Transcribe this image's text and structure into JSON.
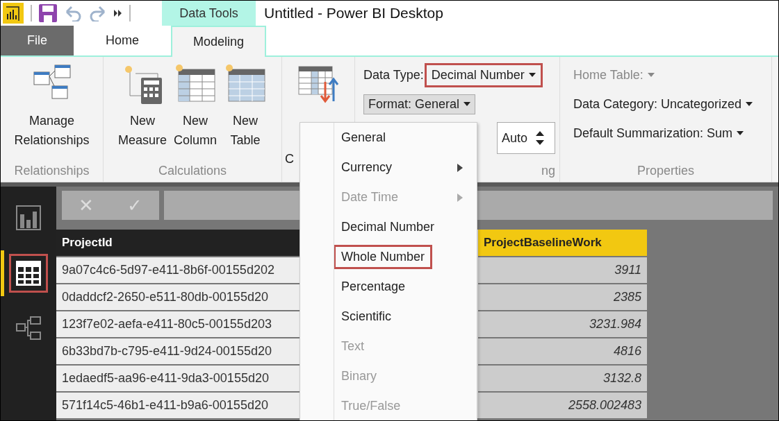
{
  "window": {
    "title": "Untitled - Power BI Desktop",
    "context_tab": "Data Tools"
  },
  "tabs": [
    {
      "label": "File",
      "kind": "file",
      "selected": false
    },
    {
      "label": "Home",
      "kind": "tab",
      "selected": false
    },
    {
      "label": "Modeling",
      "kind": "tab",
      "selected": true
    }
  ],
  "ribbon": {
    "relationships": {
      "buttons": [
        {
          "label": "Manage Relationships",
          "kind": "relationships"
        }
      ],
      "group_label": "Relationships"
    },
    "calculations": {
      "buttons": [
        {
          "label": "New Measure",
          "kind": "measure"
        },
        {
          "label": "New Column",
          "kind": "column"
        },
        {
          "label": "New Table",
          "kind": "table"
        }
      ],
      "group_label": "Calculations"
    },
    "sort": {
      "label_visible": "C"
    },
    "formatting": {
      "data_type_label": "Data Type:",
      "data_type_value": "Decimal Number",
      "data_type_highlighted": true,
      "format_button": "Format: General",
      "format_open": true,
      "decimals": "Auto",
      "group_label_visible": "ng"
    },
    "properties": {
      "items": [
        {
          "label": "Home Table:",
          "disabled": true
        },
        {
          "label": "Data Category: Uncategorized",
          "disabled": false
        },
        {
          "label": "Default Summarization: Sum",
          "disabled": false
        }
      ],
      "group_label": "Properties"
    }
  },
  "nav": [
    {
      "kind": "report",
      "selected": false,
      "highlighted": false
    },
    {
      "kind": "data",
      "selected": true,
      "highlighted": true
    },
    {
      "kind": "model",
      "selected": false,
      "highlighted": false
    }
  ],
  "formula_bar": {
    "cancel": "✕",
    "confirm": "✓"
  },
  "format_menu": [
    {
      "label": "General",
      "disabled": false,
      "submenu": false,
      "highlighted": false
    },
    {
      "label": "Currency",
      "disabled": false,
      "submenu": true,
      "highlighted": false
    },
    {
      "label": "Date Time",
      "disabled": true,
      "submenu": true,
      "highlighted": false
    },
    {
      "label": "Decimal Number",
      "disabled": false,
      "submenu": false,
      "highlighted": false
    },
    {
      "label": "Whole Number",
      "disabled": false,
      "submenu": false,
      "highlighted": true
    },
    {
      "label": "Percentage",
      "disabled": false,
      "submenu": false,
      "highlighted": false
    },
    {
      "label": "Scientific",
      "disabled": false,
      "submenu": false,
      "highlighted": false
    },
    {
      "label": "Text",
      "disabled": true,
      "submenu": false,
      "highlighted": false
    },
    {
      "label": "Binary",
      "disabled": true,
      "submenu": false,
      "highlighted": false
    },
    {
      "label": "True/False",
      "disabled": true,
      "submenu": false,
      "highlighted": false
    }
  ],
  "table": {
    "columns": [
      {
        "label": "ProjectId",
        "selected": false
      },
      {
        "label": "ProjectBaselineWork",
        "selected": true
      }
    ],
    "rows": [
      [
        "9a07c4c6-5d97-e411-8b6f-00155d202",
        "3911"
      ],
      [
        "0daddcf2-2650-e511-80db-00155d20",
        "2385"
      ],
      [
        "123f7e02-aefa-e411-80c5-00155d203",
        "3231.984"
      ],
      [
        "6b33bd7b-c795-e411-9d24-00155d20",
        "4816"
      ],
      [
        "1edaedf5-aa96-e411-9da3-00155d20",
        "3132.8"
      ],
      [
        "571f14c5-46b1-e411-b9a6-00155d20",
        "2558.002483"
      ]
    ]
  }
}
